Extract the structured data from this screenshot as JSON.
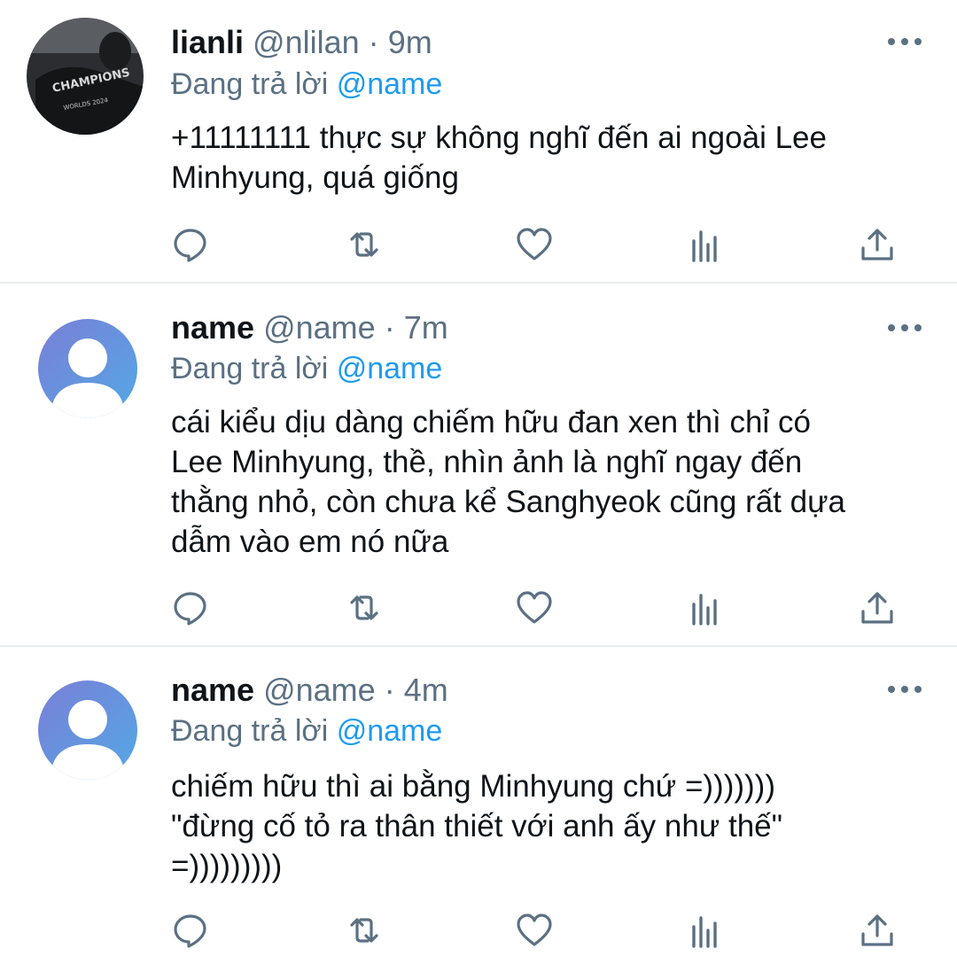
{
  "reply_prefix": "Đang trả lời",
  "tweets": [
    {
      "display_name": "lianli",
      "handle": "@nlilan",
      "time": "9m",
      "reply_to": "@name",
      "text": "+11111111 thực sự không nghĩ đến ai ngoài Lee\nMinhyung, quá giống",
      "avatar_type": "photo"
    },
    {
      "display_name": "name",
      "handle": "@name",
      "time": "7m",
      "reply_to": "@name",
      "text": "cái kiểu dịu dàng chiếm hữu đan xen thì chỉ có\nLee Minhyung, thề, nhìn ảnh là nghĩ ngay đến\nthằng nhỏ, còn chưa kể Sanghyeok cũng rất dựa\ndẫm vào em nó nữa",
      "avatar_type": "default"
    },
    {
      "display_name": "name",
      "handle": "@name",
      "time": "4m",
      "reply_to": "@name",
      "text": "chiếm hữu thì ai bằng Minhyung chứ =)))))))\n\"đừng cố tỏ ra thân thiết với anh ấy như thế\"\n=)))))))))",
      "avatar_type": "default"
    }
  ],
  "avatar_text": [
    "CHAMPIONS",
    "WORLDS 2024"
  ],
  "icons": [
    "reply-icon",
    "retweet-icon",
    "like-icon",
    "analytics-icon",
    "share-icon",
    "more-icon"
  ],
  "colors": {
    "muted": "#5b7083",
    "link": "#1d9bf0",
    "text": "#0f1419",
    "divider": "#ebeef0"
  }
}
